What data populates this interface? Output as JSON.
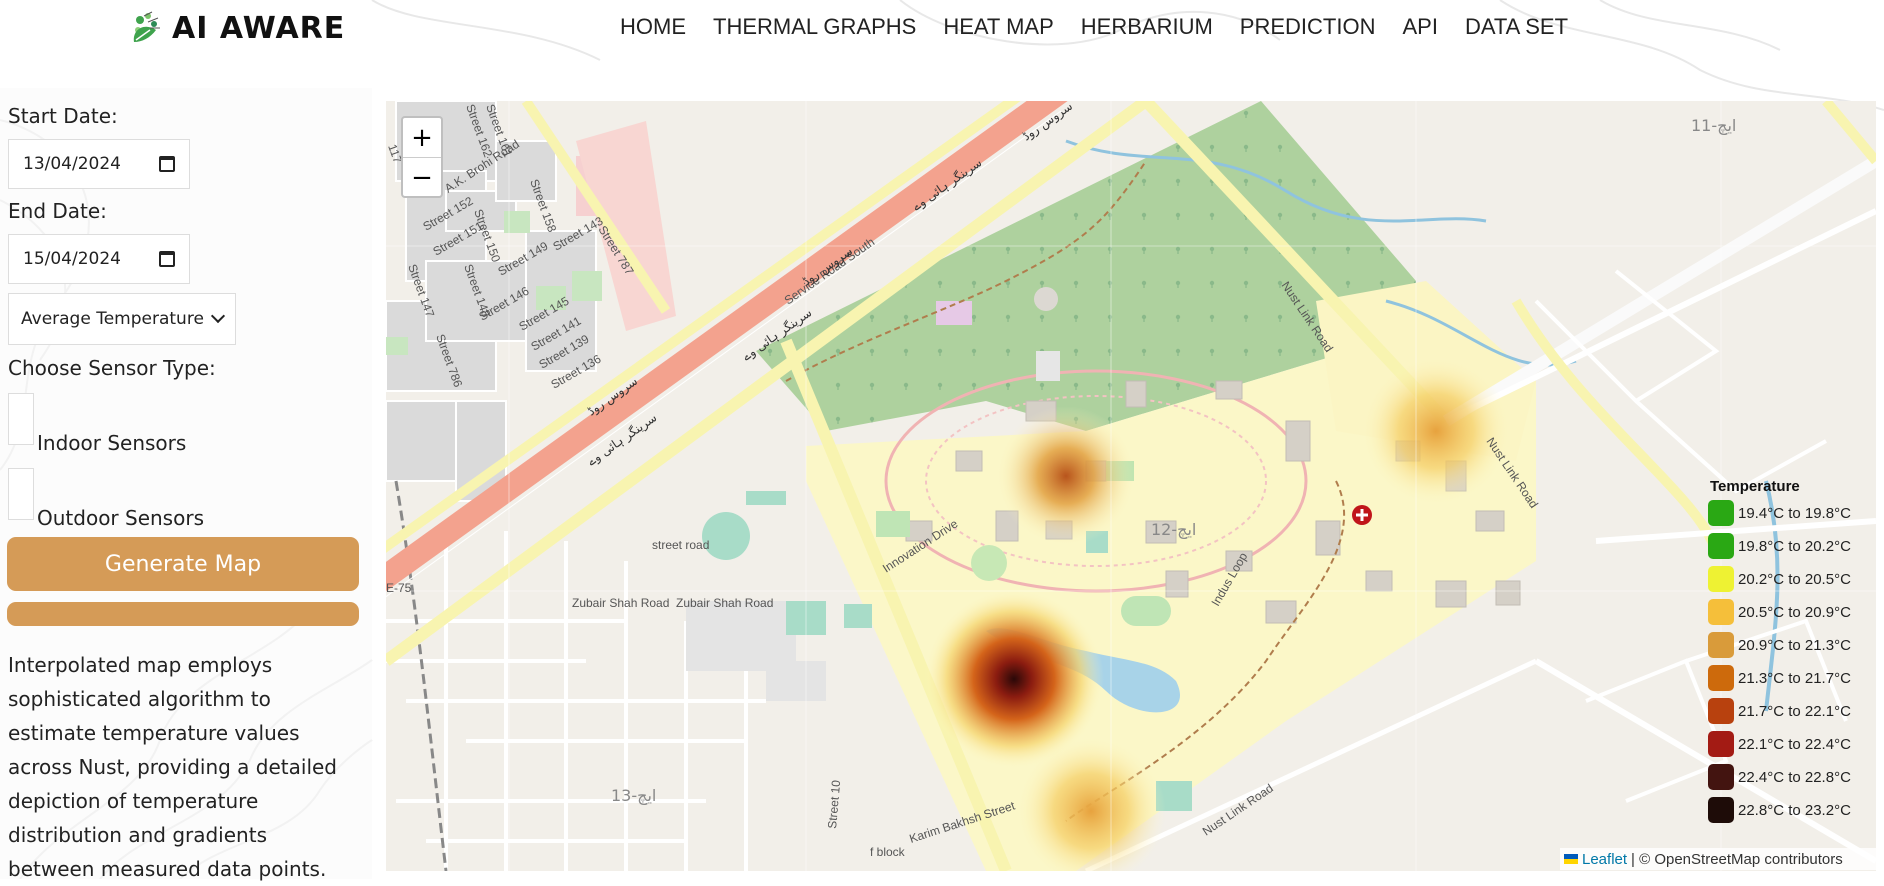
{
  "header": {
    "logo_text": "AI AWARE",
    "nav": [
      "HOME",
      "THERMAL GRAPHS",
      "HEAT MAP",
      "HERBARIUM",
      "PREDICTION",
      "API",
      "DATA SET"
    ]
  },
  "sidebar": {
    "start_date_label": "Start Date:",
    "start_date_value": "13/04/2024",
    "end_date_label": "End Date:",
    "end_date_value": "15/04/2024",
    "metric_select": "Average Temperature",
    "sensor_type_label": "Choose Sensor Type:",
    "indoor_label": "Indoor Sensors",
    "outdoor_label": "Outdoor Sensors",
    "generate_button": "Generate Map",
    "description": "Interpolated map employs sophisticated algorithm to estimate temperature values across Nust, providing a detailed depiction of temperature distribution and gradients between measured data points."
  },
  "map": {
    "zoom_in": "+",
    "zoom_out": "−",
    "labels": {
      "service_road_south": "Service Road South",
      "street_787": "Street 787",
      "nust_link_road_1": "Nust Link Road",
      "nust_link_road_2": "Nust Link Road",
      "nust_link_road_3": "Nust Link Road",
      "innovation_drive": "Innovation Drive",
      "indus_loop": "Indus Loop",
      "zubair_1": "Zubair Shah Road",
      "zubair_2": "Zubair Shah Road",
      "street_road": "street road",
      "ak_brohi": "A.K. Brohi Road",
      "street_10": "Street 10",
      "karim_bakhsh": "Karim Bakhsh Street",
      "f_block": "f block",
      "e75": "E-75",
      "sector_h12": "ایچ-12",
      "sector_h13": "ایچ-13",
      "sector_h11": "ایچ-11",
      "srinagar_1": "سرینگر ہائی وے",
      "srinagar_2": "سرینگر ہائی وے",
      "service_urdu_1": "سروس روڈ",
      "service_urdu_2": "سروس روڈ",
      "street_786": "Street 786",
      "street_152": "Street 152",
      "street_151": "Street 151",
      "street_150": "Street 150",
      "street_149": "Street 149",
      "street_148": "Street 148",
      "street_147": "Street 147",
      "street_146": "Street 146",
      "street_145": "Street 145",
      "street_141": "Street 141",
      "street_139": "Street 139",
      "street_136": "Street 136",
      "street_158": "Street 158",
      "street_143": "Street 143",
      "street_161": "Street 161",
      "street_162": "Street 162",
      "street_117": "117"
    },
    "legend_title": "Temperature",
    "legend": [
      {
        "label": "19.4°C to 19.8°C",
        "color": "#2aa814"
      },
      {
        "label": "19.8°C to 20.2°C",
        "color": "#2aa814"
      },
      {
        "label": "20.2°C to 20.5°C",
        "color": "#eef233"
      },
      {
        "label": "20.5°C to 20.9°C",
        "color": "#f5bf3a"
      },
      {
        "label": "20.9°C to 21.3°C",
        "color": "#d99b3a"
      },
      {
        "label": "21.3°C to 21.7°C",
        "color": "#cd6a0c"
      },
      {
        "label": "21.7°C to 22.1°C",
        "color": "#b8410e"
      },
      {
        "label": "22.1°C to 22.4°C",
        "color": "#a31b14"
      },
      {
        "label": "22.4°C to 22.8°C",
        "color": "#431410"
      },
      {
        "label": "22.8°C to 23.2°C",
        "color": "#1e0c08"
      }
    ],
    "attribution_link": "Leaflet",
    "attribution_text": "| © OpenStreetMap contributors"
  },
  "colors": {
    "accent": "#d59b57",
    "link": "#0078a8"
  }
}
